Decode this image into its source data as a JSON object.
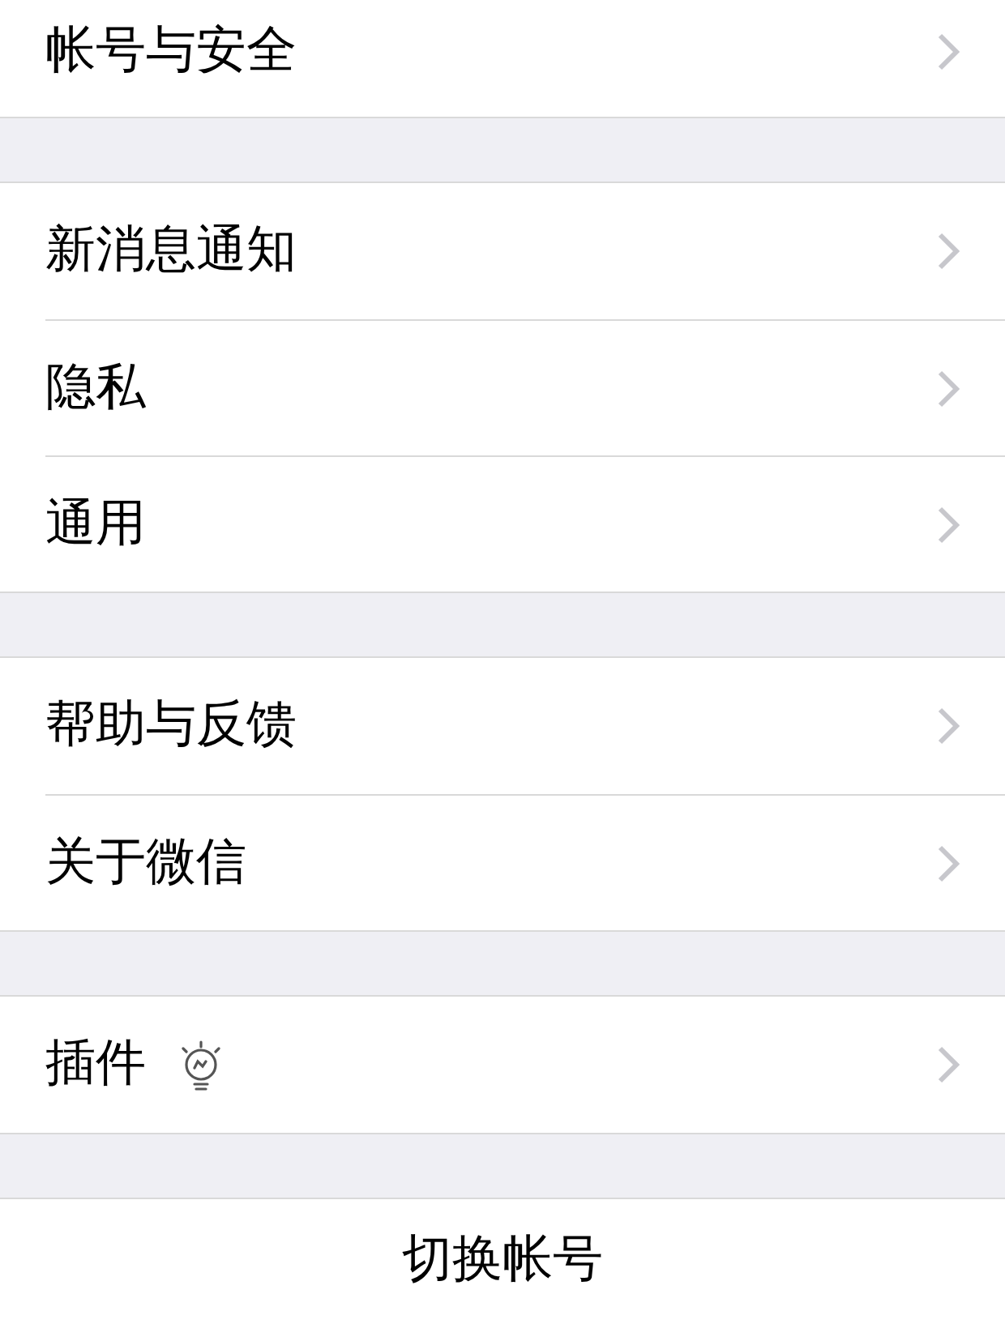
{
  "groups": [
    {
      "items": [
        {
          "label": "帐号与安全",
          "kind": "plain"
        }
      ]
    },
    {
      "items": [
        {
          "label": "新消息通知",
          "kind": "plain"
        },
        {
          "label": "隐私",
          "kind": "plain"
        },
        {
          "label": "通用",
          "kind": "plain"
        }
      ]
    },
    {
      "items": [
        {
          "label": "帮助与反馈",
          "kind": "plain"
        },
        {
          "label": "关于微信",
          "kind": "plain"
        }
      ]
    },
    {
      "items": [
        {
          "label": "插件",
          "kind": "with-icon"
        }
      ]
    }
  ],
  "action": {
    "label": "切换帐号"
  }
}
